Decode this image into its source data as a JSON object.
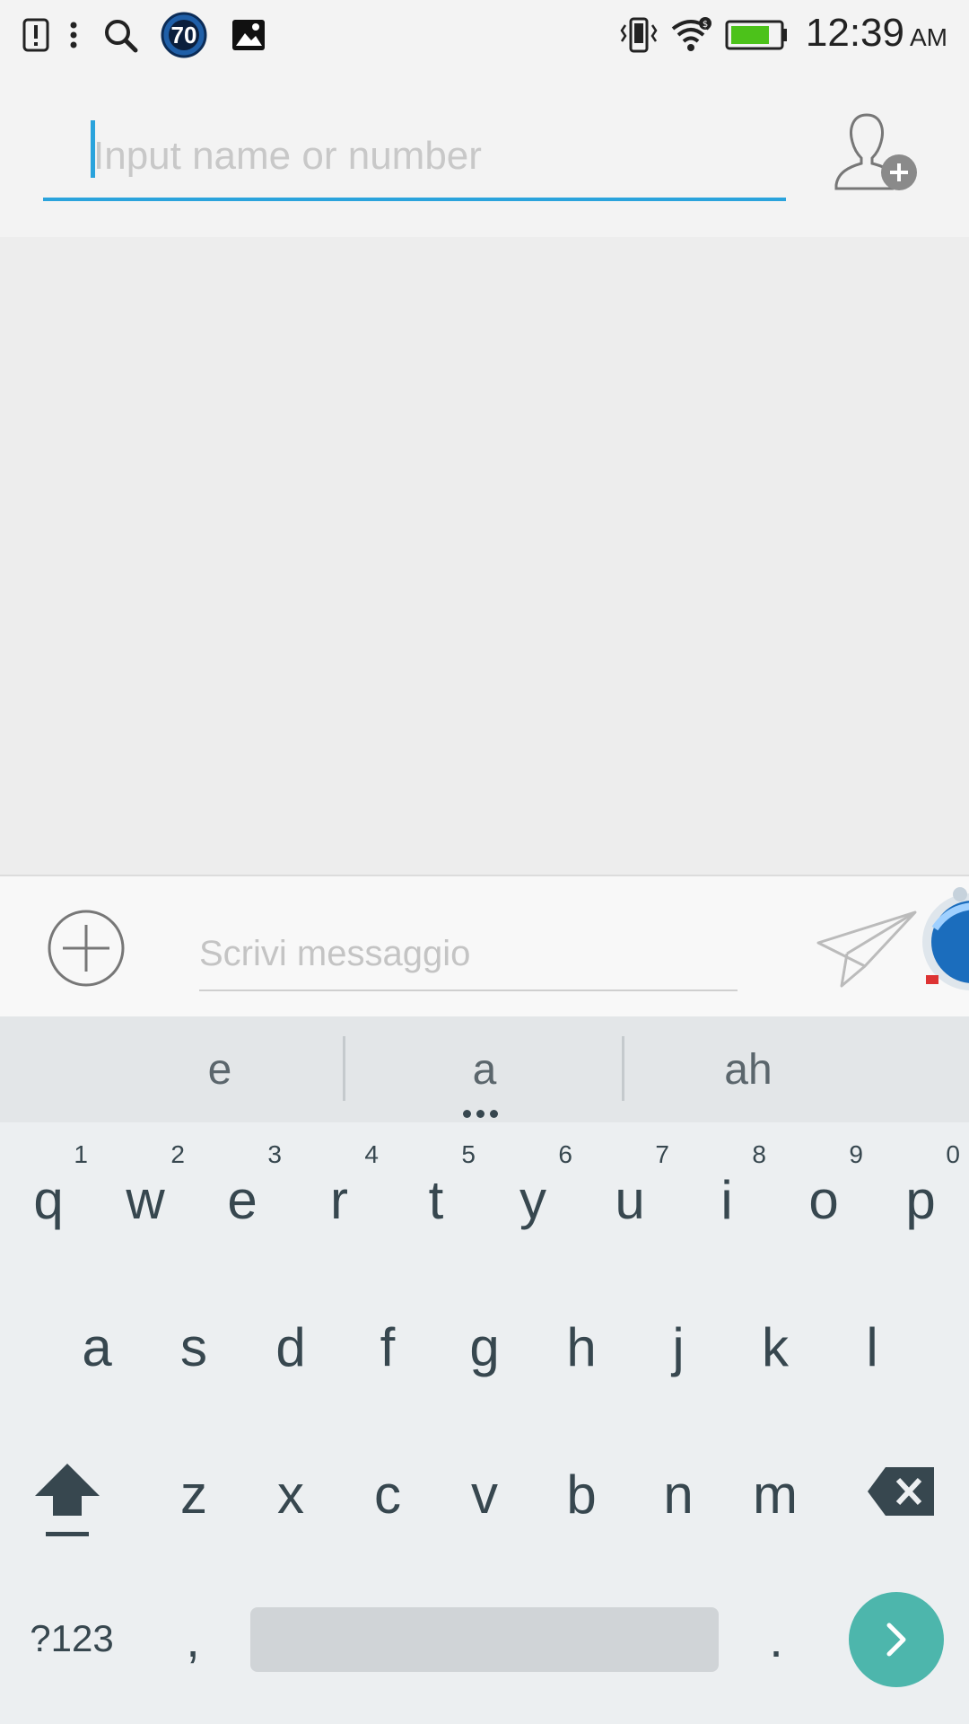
{
  "status_bar": {
    "badge_number": "70",
    "time": "12:39",
    "ampm": "AM",
    "battery_color": "#4cc21a"
  },
  "recipient": {
    "placeholder": "Input name or number"
  },
  "compose": {
    "placeholder": "Scrivi messaggio"
  },
  "keyboard": {
    "suggestions": [
      "e",
      "a",
      "ah"
    ],
    "row1": [
      {
        "key": "q",
        "hint": "1"
      },
      {
        "key": "w",
        "hint": "2"
      },
      {
        "key": "e",
        "hint": "3"
      },
      {
        "key": "r",
        "hint": "4"
      },
      {
        "key": "t",
        "hint": "5"
      },
      {
        "key": "y",
        "hint": "6"
      },
      {
        "key": "u",
        "hint": "7"
      },
      {
        "key": "i",
        "hint": "8"
      },
      {
        "key": "o",
        "hint": "9"
      },
      {
        "key": "p",
        "hint": "0"
      }
    ],
    "row2": [
      "a",
      "s",
      "d",
      "f",
      "g",
      "h",
      "j",
      "k",
      "l"
    ],
    "row3": [
      "z",
      "x",
      "c",
      "v",
      "b",
      "n",
      "m"
    ],
    "symbols_label": "?123",
    "comma_label": ",",
    "period_label": ".",
    "accent_color": "#4db6ac"
  }
}
